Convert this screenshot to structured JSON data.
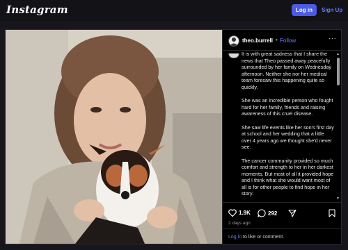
{
  "header": {
    "logo_text": "Instagram",
    "login_label": "Log in",
    "signup_label": "Sign Up"
  },
  "post": {
    "username": "theo.burrell",
    "separator": "•",
    "follow_label": "Follow",
    "more_label": "···",
    "caption_paragraphs": [
      "It is with great sadness that I share the news that Theo passed away peacefully surrounded by her family on Wednesday afternoon. Neither she nor her medical team foresaw this happening quite so quickly.",
      "She was an incredible person who fought hard for her family, friends and raising awareness of this cruel disease.",
      "She saw life events like her son's first day at school and her wedding that a little over 4 years ago we thought she'd never see.",
      "The cancer community provided so much comfort and strength to her in her darkest moments. But most of all it provided hope and I think what she would want most of all is for other people to find hope in her story."
    ],
    "likes": "1.9K",
    "comments": "292",
    "time_ago": "2 days ago",
    "login_prompt_link": "Log in",
    "login_prompt_text": " to like or comment."
  },
  "icons": {
    "like": "heart-icon",
    "comment": "comment-bubble-icon",
    "share": "share-plane-icon",
    "save": "bookmark-icon"
  },
  "colors": {
    "accent": "#4c5be4",
    "link": "#6b7cff",
    "background": "#16161c"
  }
}
